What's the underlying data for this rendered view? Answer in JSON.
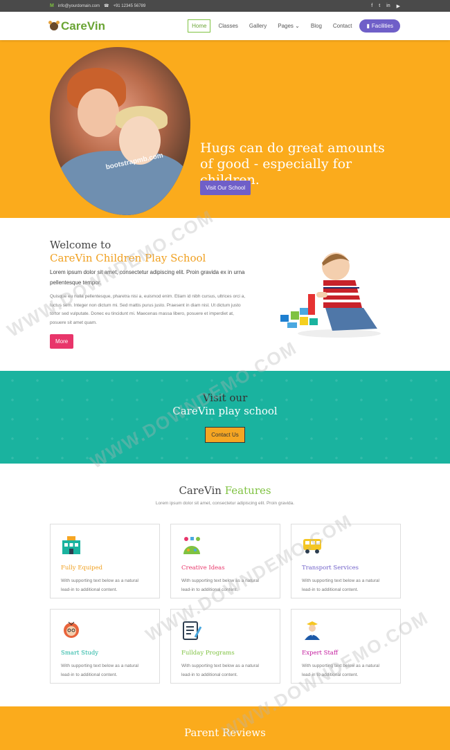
{
  "topbar": {
    "email": "info@yourdomain.com",
    "phone": "+91 12345 56789",
    "social_icons": [
      "facebook-icon",
      "twitter-icon",
      "linkedin-icon",
      "youtube-icon"
    ],
    "social_glyphs": [
      "f",
      "t",
      "in",
      "▶"
    ]
  },
  "header": {
    "logo_part1": "Care",
    "logo_part2": "Vin",
    "nav": [
      "Home",
      "Classes",
      "Gallery",
      "Pages",
      "Blog",
      "Contact"
    ],
    "active_nav": "Home",
    "facilities_label": "Facilities"
  },
  "hero": {
    "headline": "Hugs can do great amounts of good - especially for children.",
    "button": "Visit Our School",
    "image_watermark": "bootstrapmb.com",
    "slide_count": 3,
    "active_slide": 1,
    "background_color": "#fbab1c"
  },
  "welcome": {
    "title_line1": "Welcome to",
    "title_line2": "CareVin Children Play School",
    "lead": "Lorem ipsum dolor sit amet, consectetur adipiscing elit. Proin gravida ex in urna pellentesque tempor.",
    "body": "Quisque eu nulla pellentesque, pharetra nisi a, euismod enim. Etiam id nibh cursus, ultrices orci a, luctus sem. Integer non dictum mi. Sed mattis purus justo. Praesent in diam nisl. Ut dictum justo tortor sed vulputate. Donec eu tincidunt mi. Maecenas massa libero, posuere et imperdiet at, posuere sit amet quam.",
    "more_button": "More"
  },
  "visit": {
    "line1": "Visit our",
    "line2": "CareVin play school",
    "button": "Contact Us",
    "background_color": "#1ab39f"
  },
  "features": {
    "title_part1": "CareVin",
    "title_part2": "Features",
    "subtitle": "Lorem ipsum dolor sit amet, consectetur adipiscing elit. Proin gravida.",
    "items": [
      {
        "title": "Fully Equiped",
        "text": "With supporting text below as a natural lead-in to additional content.",
        "color": "#f0a020",
        "icon": "school-building-icon"
      },
      {
        "title": "Creative Ideas",
        "text": "With supporting text below as a natural lead-in to additional content.",
        "color": "#e8356a",
        "icon": "creative-toys-icon"
      },
      {
        "title": "Transport Services",
        "text": "With supporting text below as a natural lead-in to additional content.",
        "color": "#6f5fc8",
        "icon": "school-bus-icon"
      },
      {
        "title": "Smart Study",
        "text": "With supporting text below as a natural lead-in to additional content.",
        "color": "#1ab39f",
        "icon": "smart-study-icon"
      },
      {
        "title": "Fullday Programs",
        "text": "With supporting text below as a natural lead-in to additional content.",
        "color": "#7fc241",
        "icon": "program-list-icon"
      },
      {
        "title": "Expert Staff",
        "text": "With supporting text below as a natural lead-in to additional content.",
        "color": "#c2189c",
        "icon": "expert-staff-icon"
      }
    ]
  },
  "reviews": {
    "title": "Parent Reviews"
  },
  "watermark": "WWW.DOWNDEMO.COM"
}
